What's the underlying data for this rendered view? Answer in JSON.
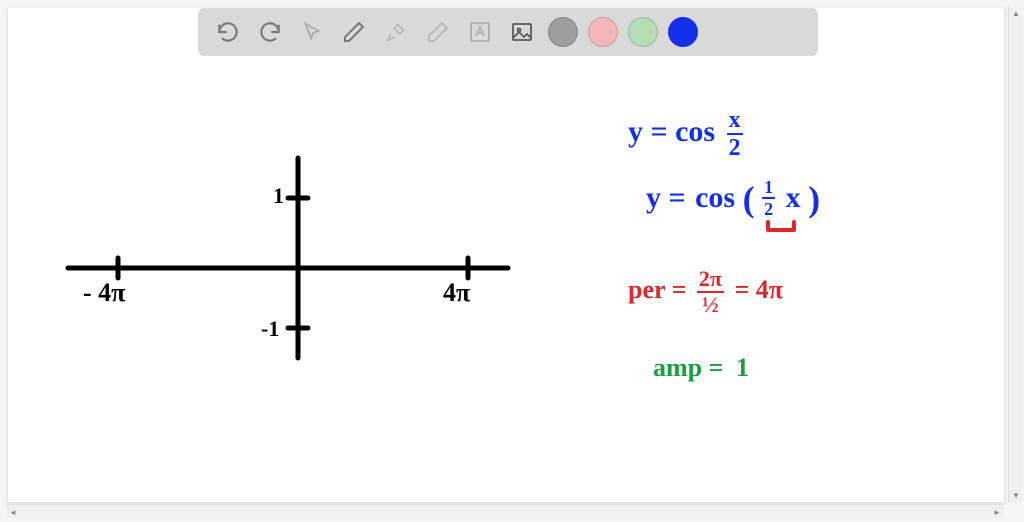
{
  "toolbar": {
    "swatches": {
      "gray": "#9e9e9e",
      "pink": "#f4b7b7",
      "green": "#b5dcb5",
      "blue": "#1330e8"
    }
  },
  "axes": {
    "y_pos": "1",
    "y_neg": "-1",
    "x_neg": "- 4π",
    "x_pos": "4π"
  },
  "eq1": {
    "lhs": "y =",
    "fn": "cos",
    "num": "x",
    "den": "2"
  },
  "eq2": {
    "lhs": "y =",
    "fn": "cos",
    "open": "(",
    "num": "1",
    "den": "2",
    "var": "x",
    "close": ")"
  },
  "per": {
    "label": "per =",
    "num": "2π",
    "den": "½",
    "eq": "= 4π"
  },
  "amp": {
    "label": "amp =",
    "value": "1"
  },
  "colors": {
    "blue": "#1330e8",
    "red": "#e0252b",
    "green": "#18a03c",
    "black": "#000000"
  }
}
